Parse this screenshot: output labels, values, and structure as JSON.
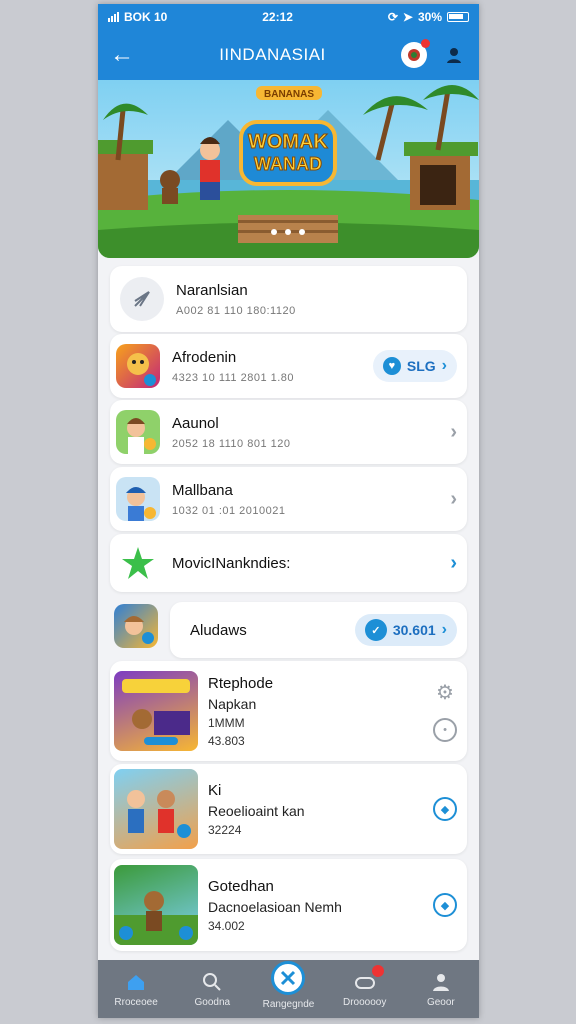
{
  "status": {
    "left": "BOK 10",
    "time": "22:12",
    "right": "30%"
  },
  "header": {
    "title": "IINDANASIAI"
  },
  "banner": {
    "ribbon": "BANANAS",
    "logo_line1": "WOMAK",
    "logo_line2": "WANAD"
  },
  "rows": [
    {
      "title": "Naranlsian",
      "sub": "A002 81 110 180:1120"
    },
    {
      "title": "Afrodenin",
      "sub": "4323 10 111 2801 1.80",
      "pill": "SLG"
    },
    {
      "title": "Aaunol",
      "sub": "2052 18 1110 801 120"
    },
    {
      "title": "Mallbana",
      "sub": "1032 01 :01 2010021"
    },
    {
      "title": "MovicINankndies:"
    }
  ],
  "section": {
    "title": "Aludaws",
    "pill": "30.601"
  },
  "games": [
    {
      "title": "Rtephode",
      "line2": "Napkan",
      "line3": "1MMM",
      "line4": "43.803"
    },
    {
      "title": "Ki",
      "line2": "Reoelioaint kan",
      "line3": "32224"
    },
    {
      "title": "Gotedhan",
      "line2": "Dacnoelasioan Nemh",
      "line3": "34.002"
    }
  ],
  "nav": [
    "Rroceoee",
    "Goodna",
    "Rangegnde",
    "Droooooy",
    "Geoor"
  ],
  "colors": {
    "primary": "#1f86d8",
    "accent": "#1d8fd6",
    "nav_bg": "#6f7782"
  }
}
